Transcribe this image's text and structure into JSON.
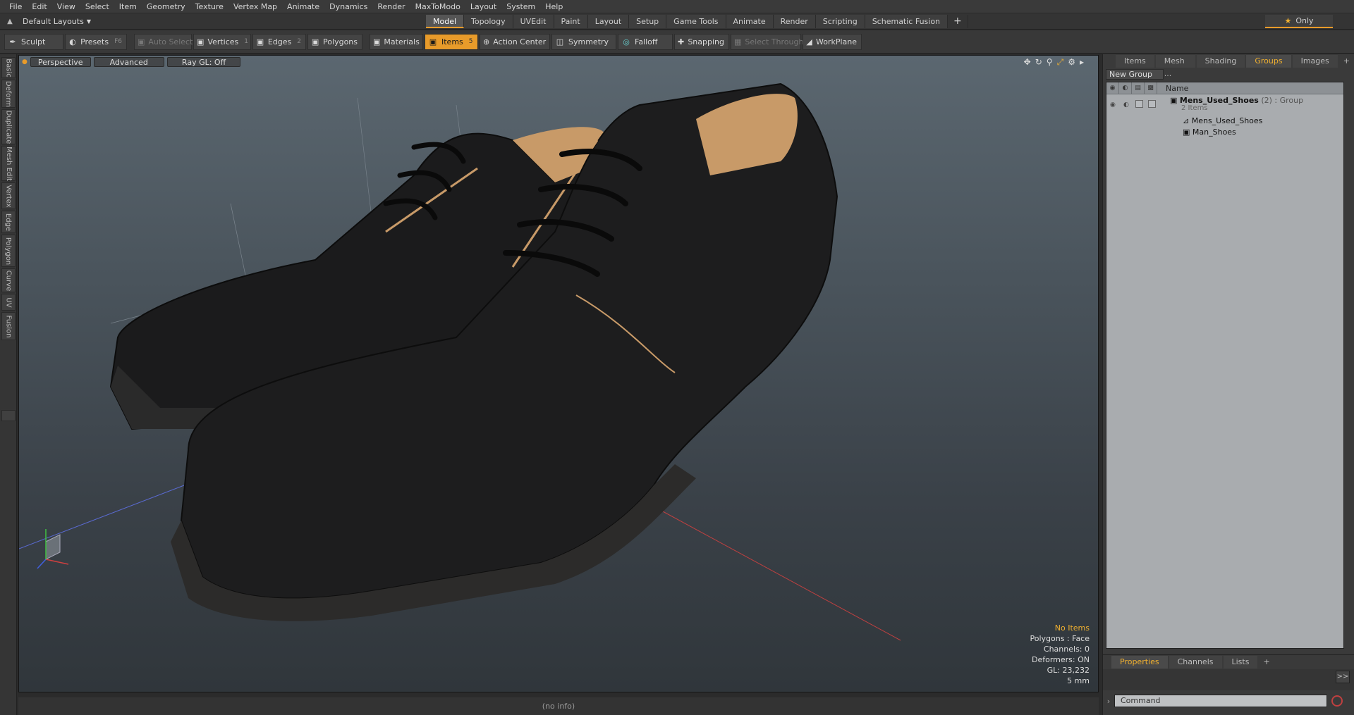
{
  "menubar": [
    "File",
    "Edit",
    "View",
    "Select",
    "Item",
    "Geometry",
    "Texture",
    "Vertex Map",
    "Animate",
    "Dynamics",
    "Render",
    "MaxToModo",
    "Layout",
    "System",
    "Help"
  ],
  "layout": {
    "name": "Default Layouts"
  },
  "mode_tabs": [
    "Model",
    "Topology",
    "UVEdit",
    "Paint",
    "Layout",
    "Setup",
    "Game Tools",
    "Animate",
    "Render",
    "Scripting",
    "Schematic Fusion"
  ],
  "active_mode": "Model",
  "only_label": "Only",
  "toolbar": {
    "sculpt": "Sculpt",
    "presets": "Presets",
    "presets_key": "F6",
    "auto_select": "Auto Select",
    "vertices": "Vertices",
    "vertices_key": "1",
    "edges": "Edges",
    "edges_key": "2",
    "polygons": "Polygons",
    "materials": "Materials",
    "items": "Items",
    "items_key": "5",
    "action_center": "Action Center",
    "symmetry": "Symmetry",
    "falloff": "Falloff",
    "snapping": "Snapping",
    "select_through": "Select Through",
    "workplane": "WorkPlane"
  },
  "left_tabs": [
    "Basic",
    "Deform",
    "Duplicate",
    "Mesh Edit",
    "Vertex",
    "Edge",
    "Polygon",
    "Curve",
    "UV",
    "Fusion"
  ],
  "viewport": {
    "view": "Perspective",
    "shading": "Advanced",
    "raygl": "Ray GL: Off",
    "info": {
      "items": "No Items",
      "polygons": "Polygons : Face",
      "channels": "Channels: 0",
      "deformers": "Deformers: ON",
      "gl": "GL: 23,232",
      "scale": "5 mm"
    }
  },
  "status": "(no info)",
  "right_panel": {
    "tabs": [
      "Items",
      "Mesh ...",
      "Shading",
      "Groups",
      "Images"
    ],
    "active_tab": "Groups",
    "new_group": "New Group",
    "column_name": "Name",
    "tree": {
      "group_name": "Mens_Used_Shoes",
      "group_count": "(2)",
      "group_type": ": Group",
      "group_sub": "2 Items",
      "child1": "Mens_Used_Shoes",
      "child2": "Man_Shoes"
    },
    "bottom_tabs": [
      "Properties",
      "Channels",
      "Lists"
    ],
    "bottom_active": "Properties",
    "arrow_label": ">>",
    "command_placeholder": "Command"
  },
  "colors": {
    "accent": "#e89b2a",
    "star": "#f0b030",
    "viewport_top": "#5b6770",
    "viewport_bottom": "#30363b"
  }
}
